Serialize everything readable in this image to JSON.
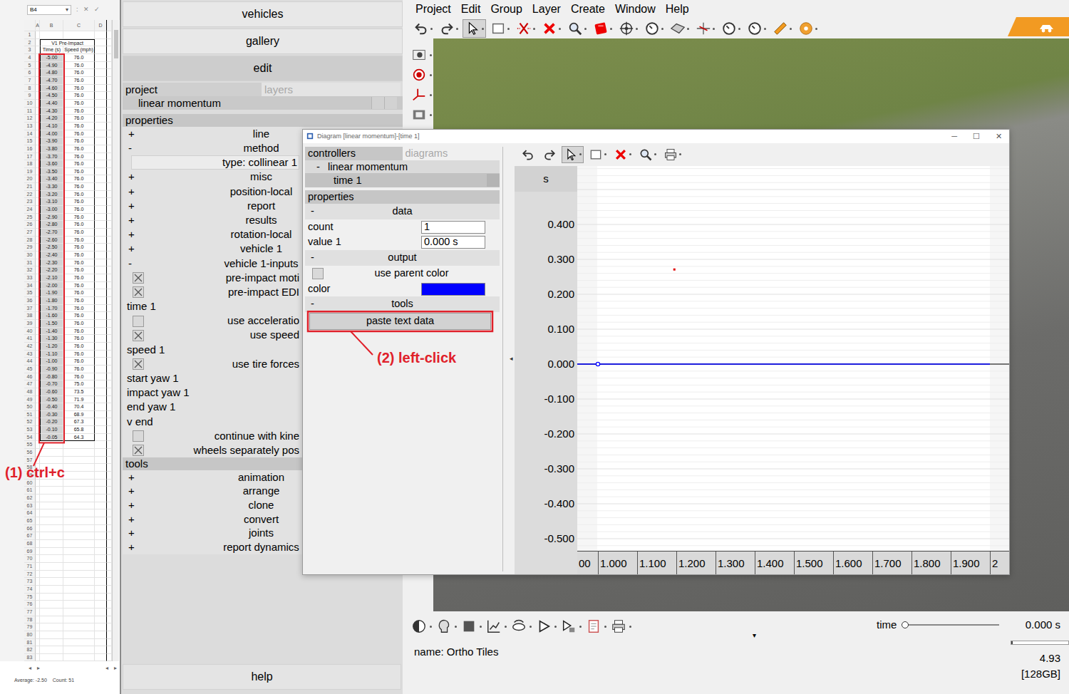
{
  "spreadsheet": {
    "name_box": "B4",
    "name_box_arrow": "▾",
    "separator": ":",
    "cancel": "✕",
    "enter": "✓",
    "columns": [
      "A",
      "B",
      "C",
      "D"
    ],
    "top_rows": [
      "1"
    ],
    "title": {
      "row": "2",
      "text": "V1 Pre-Impact"
    },
    "headers": {
      "row": "3",
      "cells": [
        "Time (s)",
        "Speed (mph)"
      ]
    },
    "rows": [
      {
        "n": "4",
        "time": "-5.00",
        "speed": "76.0",
        "selected": true
      },
      {
        "n": "5",
        "time": "-4.90",
        "speed": "76.0",
        "selected": true
      },
      {
        "n": "6",
        "time": "-4.80",
        "speed": "76.0",
        "selected": true
      },
      {
        "n": "7",
        "time": "-4.70",
        "speed": "76.0",
        "selected": true
      },
      {
        "n": "8",
        "time": "-4.60",
        "speed": "76.0",
        "selected": true
      },
      {
        "n": "9",
        "time": "-4.50",
        "speed": "76.0",
        "selected": true
      },
      {
        "n": "10",
        "time": "-4.40",
        "speed": "76.0",
        "selected": true
      },
      {
        "n": "11",
        "time": "-4.30",
        "speed": "76.0",
        "selected": true
      },
      {
        "n": "12",
        "time": "-4.20",
        "speed": "76.0",
        "selected": true
      },
      {
        "n": "13",
        "time": "-4.10",
        "speed": "76.0",
        "selected": true
      },
      {
        "n": "14",
        "time": "-4.00",
        "speed": "76.0",
        "selected": true
      },
      {
        "n": "15",
        "time": "-3.90",
        "speed": "76.0",
        "selected": true
      },
      {
        "n": "16",
        "time": "-3.80",
        "speed": "76.0",
        "selected": true
      },
      {
        "n": "17",
        "time": "-3.70",
        "speed": "76.0",
        "selected": true
      },
      {
        "n": "18",
        "time": "-3.60",
        "speed": "76.0",
        "selected": true
      },
      {
        "n": "19",
        "time": "-3.50",
        "speed": "76.0",
        "selected": true
      },
      {
        "n": "20",
        "time": "-3.40",
        "speed": "76.0",
        "selected": true
      },
      {
        "n": "21",
        "time": "-3.30",
        "speed": "76.0",
        "selected": true
      },
      {
        "n": "22",
        "time": "-3.20",
        "speed": "76.0",
        "selected": true
      },
      {
        "n": "23",
        "time": "-3.10",
        "speed": "76.0",
        "selected": true
      },
      {
        "n": "24",
        "time": "-3.00",
        "speed": "76.0",
        "selected": true
      },
      {
        "n": "25",
        "time": "-2.90",
        "speed": "76.0",
        "selected": true
      },
      {
        "n": "26",
        "time": "-2.80",
        "speed": "76.0",
        "selected": true
      },
      {
        "n": "27",
        "time": "-2.70",
        "speed": "76.0",
        "selected": true
      },
      {
        "n": "28",
        "time": "-2.60",
        "speed": "76.0",
        "selected": true
      },
      {
        "n": "29",
        "time": "-2.50",
        "speed": "76.0",
        "selected": true
      },
      {
        "n": "30",
        "time": "-2.40",
        "speed": "76.0",
        "selected": true
      },
      {
        "n": "31",
        "time": "-2.30",
        "speed": "76.0",
        "selected": true
      },
      {
        "n": "32",
        "time": "-2.20",
        "speed": "76.0",
        "selected": true
      },
      {
        "n": "33",
        "time": "-2.10",
        "speed": "76.0",
        "selected": true
      },
      {
        "n": "34",
        "time": "-2.00",
        "speed": "76.0",
        "selected": true
      },
      {
        "n": "35",
        "time": "-1.90",
        "speed": "76.0",
        "selected": true
      },
      {
        "n": "36",
        "time": "-1.80",
        "speed": "76.0",
        "selected": true
      },
      {
        "n": "37",
        "time": "-1.70",
        "speed": "76.0",
        "selected": true
      },
      {
        "n": "38",
        "time": "-1.60",
        "speed": "76.0",
        "selected": true
      },
      {
        "n": "39",
        "time": "-1.50",
        "speed": "76.0",
        "selected": true
      },
      {
        "n": "40",
        "time": "-1.40",
        "speed": "76.0",
        "selected": true
      },
      {
        "n": "41",
        "time": "-1.30",
        "speed": "76.0",
        "selected": true
      },
      {
        "n": "42",
        "time": "-1.20",
        "speed": "76.0",
        "selected": true
      },
      {
        "n": "43",
        "time": "-1.10",
        "speed": "76.0",
        "selected": true
      },
      {
        "n": "44",
        "time": "-1.00",
        "speed": "76.0",
        "selected": true
      },
      {
        "n": "45",
        "time": "-0.90",
        "speed": "76.0",
        "selected": true
      },
      {
        "n": "46",
        "time": "-0.80",
        "speed": "76.0",
        "selected": true
      },
      {
        "n": "47",
        "time": "-0.70",
        "speed": "75.0",
        "selected": true
      },
      {
        "n": "48",
        "time": "-0.60",
        "speed": "73.5",
        "selected": true
      },
      {
        "n": "49",
        "time": "-0.50",
        "speed": "71.9",
        "selected": true
      },
      {
        "n": "50",
        "time": "-0.40",
        "speed": "70.4",
        "selected": true
      },
      {
        "n": "51",
        "time": "-0.30",
        "speed": "68.9",
        "selected": true
      },
      {
        "n": "52",
        "time": "-0.20",
        "speed": "67.3",
        "selected": true
      },
      {
        "n": "53",
        "time": "-0.10",
        "speed": "65.8",
        "selected": true
      },
      {
        "n": "54",
        "time": "-0.05",
        "speed": "64.3",
        "selected": true
      }
    ],
    "blank_rows": [
      "55",
      "56",
      "57",
      "58",
      "59",
      "60",
      "61",
      "62",
      "63",
      "64",
      "65",
      "66",
      "67",
      "68",
      "69",
      "70",
      "71",
      "72",
      "73",
      "74",
      "75",
      "76",
      "77",
      "78",
      "79",
      "80",
      "81",
      "82",
      "83"
    ],
    "sheet_nav": [
      "◂",
      "▸"
    ],
    "h_scroll": [
      "◂",
      "▸"
    ],
    "status": [
      "Average: -2.50",
      "Count: 51"
    ]
  },
  "side_panel": {
    "nav_buttons": [
      {
        "label": "vehicles",
        "selected": false
      },
      {
        "label": "gallery",
        "selected": false
      },
      {
        "label": "edit",
        "selected": true
      }
    ],
    "tabs": [
      {
        "label": "project",
        "selected": true
      },
      {
        "label": "layers",
        "selected": false
      }
    ],
    "tree": [
      {
        "label": "linear momentum",
        "selected": true
      }
    ],
    "properties_title": "properties",
    "properties": [
      {
        "kind": "group",
        "toggle": "+",
        "label": "line"
      },
      {
        "kind": "group",
        "toggle": "-",
        "label": "method"
      },
      {
        "kind": "field",
        "label": "type: collinear 1"
      },
      {
        "kind": "group",
        "toggle": "+",
        "label": "misc"
      },
      {
        "kind": "group",
        "toggle": "+",
        "label": "position-local"
      },
      {
        "kind": "group",
        "toggle": "+",
        "label": "report"
      },
      {
        "kind": "group",
        "toggle": "+",
        "label": "results"
      },
      {
        "kind": "group",
        "toggle": "+",
        "label": "rotation-local"
      },
      {
        "kind": "group",
        "toggle": "+",
        "label": "vehicle 1"
      },
      {
        "kind": "group",
        "toggle": "-",
        "label": "vehicle 1-inputs"
      },
      {
        "kind": "checkbox",
        "label": "pre-impact moti",
        "checked": true
      },
      {
        "kind": "checkbox",
        "label": "pre-impact EDI",
        "checked": true
      },
      {
        "kind": "label",
        "label": "time 1"
      },
      {
        "kind": "checkbox",
        "label": "use acceleratio",
        "checked": false
      },
      {
        "kind": "checkbox",
        "label": "use speed",
        "checked": true
      },
      {
        "kind": "label",
        "label": "speed 1"
      },
      {
        "kind": "checkbox",
        "label": "use tire forces",
        "checked": true
      },
      {
        "kind": "label",
        "label": "start yaw 1"
      },
      {
        "kind": "label",
        "label": "impact yaw 1"
      },
      {
        "kind": "label",
        "label": "end yaw 1"
      },
      {
        "kind": "label",
        "label": "v end"
      },
      {
        "kind": "checkbox",
        "label": "continue with kine",
        "checked": false
      },
      {
        "kind": "checkbox",
        "label": "wheels separately pos",
        "checked": true
      }
    ],
    "tools_title": "tools",
    "tools": [
      {
        "toggle": "+",
        "label": "animation"
      },
      {
        "toggle": "+",
        "label": "arrange"
      },
      {
        "toggle": "+",
        "label": "clone"
      },
      {
        "toggle": "+",
        "label": "convert"
      },
      {
        "toggle": "+",
        "label": "joints"
      },
      {
        "toggle": "+",
        "label": "report dynamics"
      }
    ],
    "help": "help"
  },
  "app": {
    "menu": [
      "Project",
      "Edit",
      "Group",
      "Layer",
      "Create",
      "Window",
      "Help"
    ],
    "toolbar": [
      {
        "selected": false
      },
      {
        "selected": false
      },
      {
        "selected": true
      },
      {
        "selected": false
      },
      {
        "selected": false
      },
      {
        "selected": false
      },
      {
        "selected": false
      },
      {
        "selected": false
      },
      {
        "selected": false
      },
      {
        "selected": false
      },
      {
        "selected": false
      },
      {
        "selected": false
      },
      {
        "selected": false
      },
      {
        "selected": false
      },
      {
        "selected": false
      },
      {
        "selected": false
      }
    ],
    "bottom_bar": {
      "name": "name: Ortho Tiles",
      "dropdown": "▾",
      "time": {
        "label": "time",
        "level": 0,
        "reading": "0.000 s"
      },
      "memory_bar": {
        "level": 0.03
      },
      "stats": [
        "4.93",
        "[128GB]"
      ]
    }
  },
  "diagram_window": {
    "title": "Diagram [linear momentum]-[time 1]",
    "controls": [
      "─",
      "☐",
      "✕"
    ],
    "tabs": [
      {
        "label": "controllers",
        "selected": true
      },
      {
        "label": "diagrams",
        "selected": false
      }
    ],
    "tree": [
      {
        "toggle": "-",
        "label": "linear momentum",
        "selected": false
      },
      {
        "toggle": "",
        "label": "time 1",
        "selected": true
      }
    ],
    "properties_title": "properties",
    "groups": [
      {
        "toggle": "-",
        "label": "data",
        "fields": [
          {
            "kind": "input",
            "label": "count",
            "value": "1"
          },
          {
            "kind": "input",
            "label": "value 1",
            "value": "0.000 s"
          }
        ]
      },
      {
        "toggle": "-",
        "label": "output",
        "fields": [
          {
            "kind": "checkbox",
            "label": "use parent color",
            "checked": false
          },
          {
            "kind": "color",
            "label": "color",
            "color": "#0000ff"
          }
        ]
      },
      {
        "toggle": "-",
        "label": "tools",
        "fields": [
          {
            "kind": "button",
            "label": "paste text data"
          }
        ]
      }
    ],
    "toolbar": [
      {
        "selected": false
      },
      {
        "selected": false
      },
      {
        "selected": true
      },
      {
        "selected": false
      },
      {
        "selected": false
      },
      {
        "selected": false
      },
      {
        "selected": false
      }
    ],
    "splitter": "◂",
    "chart": {
      "y_label": "s",
      "y_ticks": [
        {
          "label": "0.400",
          "value": 0.4
        },
        {
          "label": "0.300",
          "value": 0.3
        },
        {
          "label": "0.200",
          "value": 0.2
        },
        {
          "label": "0.100",
          "value": 0.1
        },
        {
          "label": "0.000",
          "value": 0.0
        },
        {
          "label": "-0.100",
          "value": -0.1
        },
        {
          "label": "-0.200",
          "value": -0.2
        },
        {
          "label": "-0.300",
          "value": -0.3
        },
        {
          "label": "-0.400",
          "value": -0.4
        },
        {
          "label": "-0.500",
          "value": -0.5
        }
      ],
      "x_ticks": [
        {
          "label": "00",
          "value": 0.9
        },
        {
          "label": "1.000",
          "value": 1.0
        },
        {
          "label": "1.100",
          "value": 1.1
        },
        {
          "label": "1.200",
          "value": 1.2
        },
        {
          "label": "1.300",
          "value": 1.3
        },
        {
          "label": "1.400",
          "value": 1.4
        },
        {
          "label": "1.500",
          "value": 1.5
        },
        {
          "label": "1.600",
          "value": 1.6
        },
        {
          "label": "1.700",
          "value": 1.7
        },
        {
          "label": "1.800",
          "value": 1.8
        },
        {
          "label": "1.900",
          "value": 1.9
        },
        {
          "label": "2",
          "value": 2.0
        }
      ],
      "series": [
        {
          "name": "value 1",
          "color": "#0000ff",
          "x": [
            1.0
          ],
          "y": [
            0.0
          ]
        }
      ],
      "marker": {
        "x": 1.195,
        "y": 0.271,
        "color": "#e00000"
      }
    }
  },
  "annotations": {
    "copy": "(1) ctrl+c",
    "click": "(2) left-click"
  }
}
